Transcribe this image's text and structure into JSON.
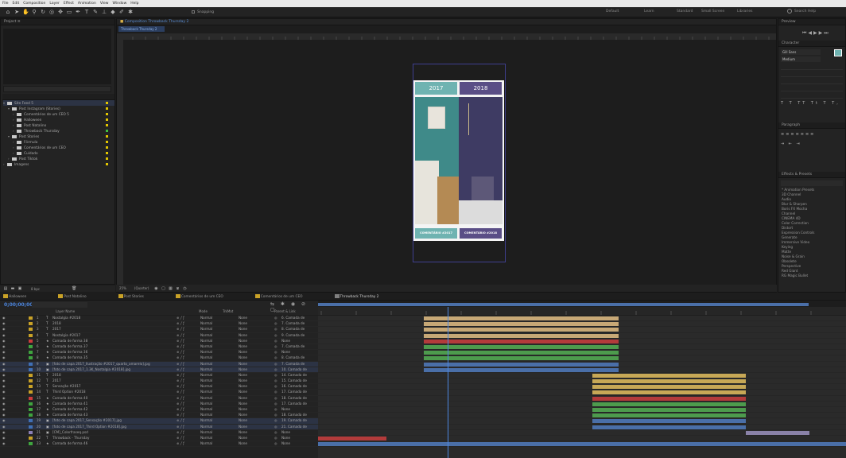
{
  "menu": [
    "File",
    "Edit",
    "Composition",
    "Layer",
    "Effect",
    "Animation",
    "View",
    "Window",
    "Help"
  ],
  "toolbar": {
    "snapping": "Snapping",
    "workspaces": [
      "Default",
      "Learn",
      "Standard",
      "Small Screen",
      "Libraries"
    ],
    "search": "Search Help"
  },
  "project": {
    "tab": "Project",
    "items": [
      {
        "name": "Site Feed 5",
        "indent": 0,
        "label": "#e2c600",
        "open": true
      },
      {
        "name": "Post Instagram (Stories)",
        "indent": 1,
        "label": "#e2c600",
        "open": true
      },
      {
        "name": "Comentários de um CEO 5",
        "indent": 2,
        "label": "#e2c600"
      },
      {
        "name": "Halloween",
        "indent": 2,
        "label": "#e2c600"
      },
      {
        "name": "Post Natalino",
        "indent": 2,
        "label": "#e2c600"
      },
      {
        "name": "Throwback Thursday",
        "indent": 2,
        "label": "#3fbf3f"
      },
      {
        "name": "Post Stories",
        "indent": 1,
        "label": "#e2c600",
        "open": true
      },
      {
        "name": "Fórmula",
        "indent": 2,
        "label": "#e2c600"
      },
      {
        "name": "Comentários de um CEO",
        "indent": 2,
        "label": "#e2c600"
      },
      {
        "name": "Cuidado",
        "indent": 2,
        "label": "#e2c600"
      },
      {
        "name": "Post Tiktok",
        "indent": 1,
        "label": "#e2c600"
      },
      {
        "name": "Imagens",
        "indent": 0,
        "label": "#e2c600"
      }
    ],
    "bpc": "8 bpc"
  },
  "composition": {
    "tab": "Composition Throwback Thursday 2",
    "subtab": "Throwback Thursday 2",
    "zoom": "(Quarter)",
    "preview": {
      "left_year": "2017",
      "right_year": "2018",
      "left_button": "COMENTÁRIO #2017",
      "right_button": "COMENTÁRIO #2018",
      "left_color": "#6fb3b1",
      "right_color": "#5a4e86"
    }
  },
  "right_panels": {
    "preview_tab": "Preview",
    "character_tab": "Character",
    "font": "Gill Sans",
    "font_style": "Medium",
    "paragraph_tab": "Paragraph",
    "effects_tab": "Effects & Presets",
    "effects": [
      "* Animation Presets",
      "3D Channel",
      "Audio",
      "Blur & Sharpen",
      "Boris FX Mocha",
      "Channel",
      "CINEMA 4D",
      "Color Correction",
      "Distort",
      "Expression Controls",
      "Generate",
      "Immersive Video",
      "Keying",
      "Matte",
      "Noise & Grain",
      "Obsolete",
      "Perspective",
      "Red Giant",
      "RG Magic Bullet"
    ]
  },
  "timeline": {
    "timecode": "0;00;00;00",
    "tabs": [
      "Halloween",
      "Post Natalino",
      "Post Stories",
      "Comentários de um CEO",
      "Comentários de um CEO",
      "Throwback Thursday 2"
    ],
    "tab_colors": [
      "#c9a227",
      "#c9a227",
      "#c9a227",
      "#c9a227",
      "#c9a227",
      "#7f7f7f"
    ],
    "columns": {
      "layer": "Layer Name",
      "mode": "Mode",
      "trkmat": "TrkMat",
      "parent": "Parent & Link"
    },
    "layers": [
      {
        "num": "1",
        "name": "Nostalgia #2018",
        "color": "#c9a227",
        "mode": "Normal",
        "trk": "None",
        "parent": "6. Camada de"
      },
      {
        "num": "2",
        "name": "2018",
        "color": "#c9a227",
        "mode": "Normal",
        "trk": "None",
        "parent": "7. Camada de"
      },
      {
        "num": "3",
        "name": "2017",
        "color": "#c9a227",
        "mode": "Normal",
        "trk": "None",
        "parent": "8. Camada de"
      },
      {
        "num": "4",
        "name": "Nostalgia #2017",
        "color": "#c9a227",
        "mode": "Normal",
        "trk": "None",
        "parent": "9. Camada de"
      },
      {
        "num": "5",
        "name": "Camada de forma 38",
        "color": "#cc3b3b",
        "mode": "Normal",
        "trk": "None",
        "parent": "None"
      },
      {
        "num": "6",
        "name": "Camada de forma 37",
        "color": "#3fa53f",
        "mode": "Normal",
        "trk": "None",
        "parent": "7. Camada de"
      },
      {
        "num": "7",
        "name": "Camada de forma 36",
        "color": "#3fa53f",
        "mode": "Normal",
        "trk": "None",
        "parent": "None"
      },
      {
        "num": "8",
        "name": "Camada de forma 35",
        "color": "#3fa53f",
        "mode": "Normal",
        "trk": "None",
        "parent": "8. Camada de"
      },
      {
        "num": "9",
        "name": "[foto de capa 2017_Ilustração #2017_quarto_amarelo].jpg",
        "color": "#3f6fb5",
        "mode": "Normal",
        "trk": "None",
        "parent": "7. Camada de"
      },
      {
        "num": "10",
        "name": "[foto de capa 2017_1.3K_Nostalgia #2018].jpg",
        "color": "#3f6fb5",
        "mode": "Normal",
        "trk": "None",
        "parent": "10. Camada de"
      },
      {
        "num": "11",
        "name": "2018",
        "color": "#c9a227",
        "mode": "Normal",
        "trk": "None",
        "parent": "14. Camada de"
      },
      {
        "num": "12",
        "name": "2017",
        "color": "#c9a227",
        "mode": "Normal",
        "trk": "None",
        "parent": "15. Camada de"
      },
      {
        "num": "13",
        "name": "Sensação #2017",
        "color": "#c9a227",
        "mode": "Normal",
        "trk": "None",
        "parent": "16. Camada de"
      },
      {
        "num": "14",
        "name": "Third Option #2018",
        "color": "#c9a227",
        "mode": "Normal",
        "trk": "None",
        "parent": "17. Camada de"
      },
      {
        "num": "15",
        "name": "Camada de forma 40",
        "color": "#cc3b3b",
        "mode": "Normal",
        "trk": "None",
        "parent": "18. Camada de"
      },
      {
        "num": "16",
        "name": "Camada de forma 41",
        "color": "#3fa53f",
        "mode": "Normal",
        "trk": "None",
        "parent": "17. Camada de"
      },
      {
        "num": "17",
        "name": "Camada de forma 42",
        "color": "#3fa53f",
        "mode": "Normal",
        "trk": "None",
        "parent": "None"
      },
      {
        "num": "18",
        "name": "Camada de forma 43",
        "color": "#3fa53f",
        "mode": "Normal",
        "trk": "None",
        "parent": "18. Camada de"
      },
      {
        "num": "19",
        "name": "[foto de capa 2017_Sensação #2017].jpg",
        "color": "#3f6fb5",
        "mode": "Normal",
        "trk": "None",
        "parent": "19. Camada de"
      },
      {
        "num": "20",
        "name": "[foto de capa 2017_Third Option #2018].jpg",
        "color": "#3f6fb5",
        "mode": "Normal",
        "trk": "None",
        "parent": "21. Camada de"
      },
      {
        "num": "21",
        "name": "[CM]_Colorfraseq.psd",
        "color": "#8a7fb5",
        "mode": "Normal",
        "trk": "None",
        "parent": "None"
      },
      {
        "num": "22",
        "name": "Throwback - Thursday",
        "color": "#c9a227",
        "mode": "Normal",
        "trk": "None",
        "parent": "None"
      },
      {
        "num": "23",
        "name": "Camada de forma 46",
        "color": "#3fa53f",
        "mode": "Normal",
        "trk": "None",
        "parent": "None"
      }
    ],
    "bars": [
      {
        "start": 0.2,
        "end": 0.57,
        "color": "#c7a876"
      },
      {
        "start": 0.2,
        "end": 0.57,
        "color": "#c7a876"
      },
      {
        "start": 0.2,
        "end": 0.57,
        "color": "#c7a876"
      },
      {
        "start": 0.2,
        "end": 0.57,
        "color": "#c7a876"
      },
      {
        "start": 0.2,
        "end": 0.57,
        "color": "#b33b3b"
      },
      {
        "start": 0.2,
        "end": 0.57,
        "color": "#4d9b4d"
      },
      {
        "start": 0.2,
        "end": 0.57,
        "color": "#4d9b4d"
      },
      {
        "start": 0.2,
        "end": 0.57,
        "color": "#4d9b4d"
      },
      {
        "start": 0.2,
        "end": 0.57,
        "color": "#4a6fa8"
      },
      {
        "start": 0.2,
        "end": 0.57,
        "color": "#4a6fa8"
      },
      {
        "start": 0.52,
        "end": 0.81,
        "color": "#c7a856"
      },
      {
        "start": 0.52,
        "end": 0.81,
        "color": "#c7a856"
      },
      {
        "start": 0.52,
        "end": 0.81,
        "color": "#c7a856"
      },
      {
        "start": 0.52,
        "end": 0.81,
        "color": "#c7a856"
      },
      {
        "start": 0.52,
        "end": 0.81,
        "color": "#b33b3b"
      },
      {
        "start": 0.52,
        "end": 0.81,
        "color": "#4d9b4d"
      },
      {
        "start": 0.52,
        "end": 0.81,
        "color": "#4d9b4d"
      },
      {
        "start": 0.52,
        "end": 0.81,
        "color": "#4d9b4d"
      },
      {
        "start": 0.52,
        "end": 0.81,
        "color": "#4a6fa8"
      },
      {
        "start": 0.52,
        "end": 0.81,
        "color": "#4a6fa8"
      },
      {
        "start": 0.81,
        "end": 0.93,
        "color": "#8a82a8"
      },
      {
        "start": 0.0,
        "end": 0.13,
        "color": "#b33b3b"
      },
      {
        "start": 0.0,
        "end": 1.0,
        "color": "#4a6fa8"
      }
    ],
    "playhead": 0.245
  }
}
